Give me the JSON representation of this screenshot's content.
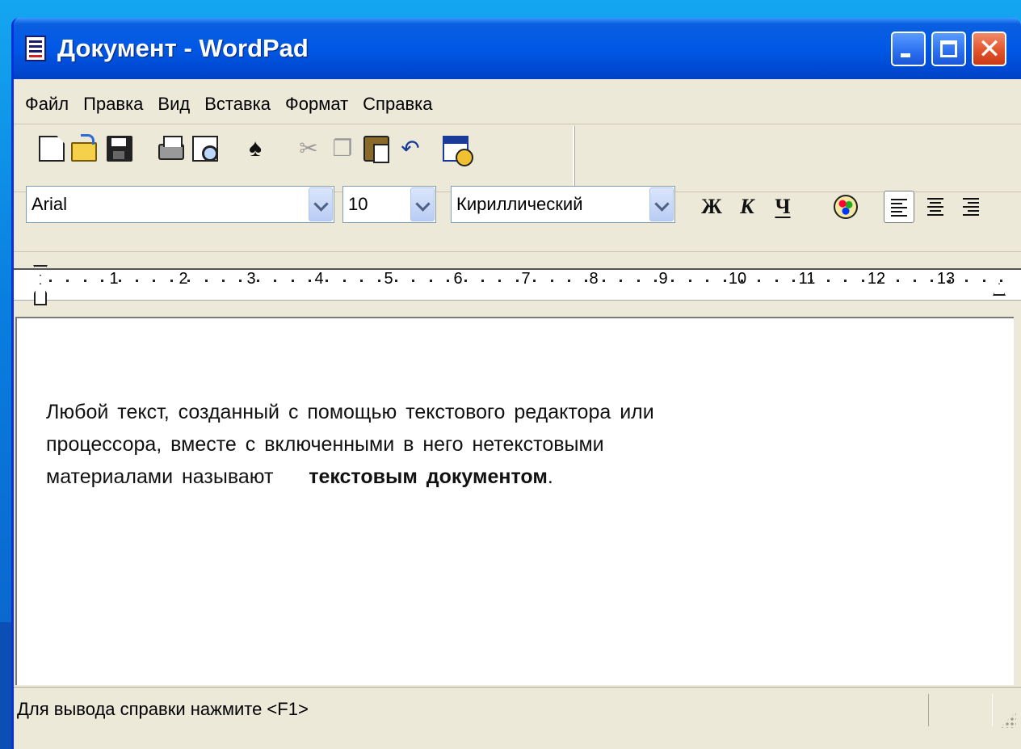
{
  "window": {
    "title": "Документ - WordPad",
    "icon": "wordpad-doc-icon",
    "controls": [
      "minimize",
      "maximize",
      "close"
    ],
    "accent": "#0058e6",
    "close_color": "#e2542c"
  },
  "menu": {
    "items": [
      "Файл",
      "Правка",
      "Вид",
      "Вставка",
      "Формат",
      "Справка"
    ]
  },
  "toolbar": {
    "buttons": [
      "new-icon",
      "open-icon",
      "save-icon",
      "print-icon",
      "print-preview-icon",
      "find-icon",
      "cut-icon",
      "copy-icon",
      "paste-icon",
      "undo-icon",
      "date-time-icon"
    ],
    "cut_glyph": "✂",
    "copy_glyph": "❐",
    "undo_glyph": "↶",
    "find_glyph": "♠"
  },
  "format": {
    "font": "Arial",
    "size": "10",
    "script": "Кириллический",
    "bold": "Ж",
    "italic": "К",
    "underline": "Ч"
  },
  "ruler": {
    "numbers": [
      "1",
      "2",
      "3",
      "4",
      "5",
      "6",
      "7",
      "8",
      "9",
      "10",
      "11",
      "12",
      "13"
    ]
  },
  "document": {
    "line1": "Любой текст, созданный с помощью текстового редактора или",
    "line2": "процессора, вместе с включенными в него нетекстовыми",
    "line3_plain": "материалами называют",
    "line3_bold": "текстовым документом",
    "line3_end": "."
  },
  "status": {
    "text": "Для вывода справки нажмите <F1>"
  }
}
